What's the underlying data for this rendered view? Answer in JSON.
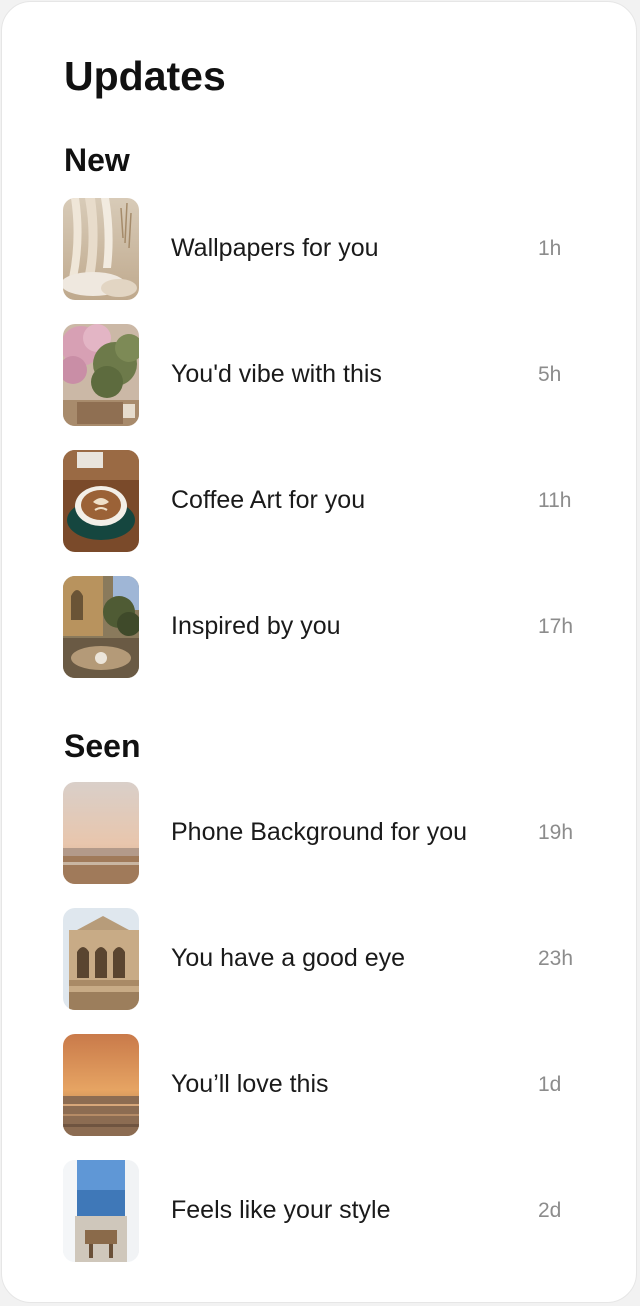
{
  "page": {
    "title": "Updates"
  },
  "sections": {
    "new": {
      "title": "New",
      "items": [
        {
          "title": "Wallpapers for you",
          "time": "1h",
          "image": "beige-curtain-photo"
        },
        {
          "title": "You'd vibe with this",
          "time": "5h",
          "image": "blossom-tree-photo"
        },
        {
          "title": "Coffee Art for you",
          "time": "11h",
          "image": "latte-art-photo"
        },
        {
          "title": "Inspired by you",
          "time": "17h",
          "image": "outdoor-cafe-photo"
        }
      ]
    },
    "seen": {
      "title": "Seen",
      "items": [
        {
          "title": "Phone Background for you",
          "time": "19h",
          "image": "beach-horizon-photo"
        },
        {
          "title": "You have a good eye",
          "time": "23h",
          "image": "palace-balcony-photo"
        },
        {
          "title": "You’ll love this",
          "time": "1d",
          "image": "sunset-sea-photo"
        },
        {
          "title": "Feels like your style",
          "time": "2d",
          "image": "sea-window-photo"
        }
      ]
    }
  },
  "colors": {
    "background": "#ffffff",
    "text_primary": "#111111",
    "text_secondary": "#8c8c8c"
  }
}
